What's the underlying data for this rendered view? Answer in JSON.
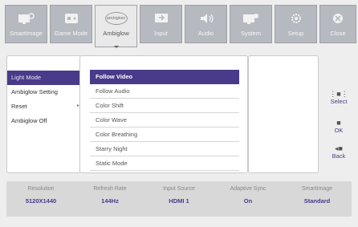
{
  "tabs": [
    {
      "label": "SmartImage",
      "icon": "smartimage-icon"
    },
    {
      "label": "Game Mode",
      "icon": "gamepad-icon"
    },
    {
      "label": "Ambiglow",
      "icon": "ambiglow-icon",
      "icon_text": "ambiglow"
    },
    {
      "label": "Input",
      "icon": "input-icon"
    },
    {
      "label": "Audio",
      "icon": "speaker-icon"
    },
    {
      "label": "System",
      "icon": "system-icon"
    },
    {
      "label": "Setup",
      "icon": "gear-icon"
    },
    {
      "label": "Close",
      "icon": "close-icon"
    }
  ],
  "active_tab": "Ambiglow",
  "left_menu": {
    "items": [
      "Light Mode",
      "Ambiglow Setting",
      "Reset",
      "Ambiglow Off"
    ],
    "selected": "Light Mode"
  },
  "options": {
    "items": [
      "Follow Video",
      "Follow Audio",
      "Color Shift",
      "Color Wave",
      "Color Breathing",
      "Starry Night",
      "Static Mode"
    ],
    "selected": "Follow Video"
  },
  "controls": [
    {
      "label": "Select",
      "icon": "select-icon"
    },
    {
      "label": "OK",
      "icon": "ok-icon"
    },
    {
      "label": "Back",
      "icon": "back-icon"
    }
  ],
  "status": [
    {
      "key": "Resolution",
      "value": "5120X1440"
    },
    {
      "key": "Refresh Rate",
      "value": "144Hz"
    },
    {
      "key": "Input Source",
      "value": "HDMI 1"
    },
    {
      "key": "Adaptive Sync",
      "value": "On"
    },
    {
      "key": "SmartImage",
      "value": "Standard"
    }
  ],
  "colors": {
    "accent": "#4a3a8a",
    "tab_bg": "#b6b9bf"
  }
}
